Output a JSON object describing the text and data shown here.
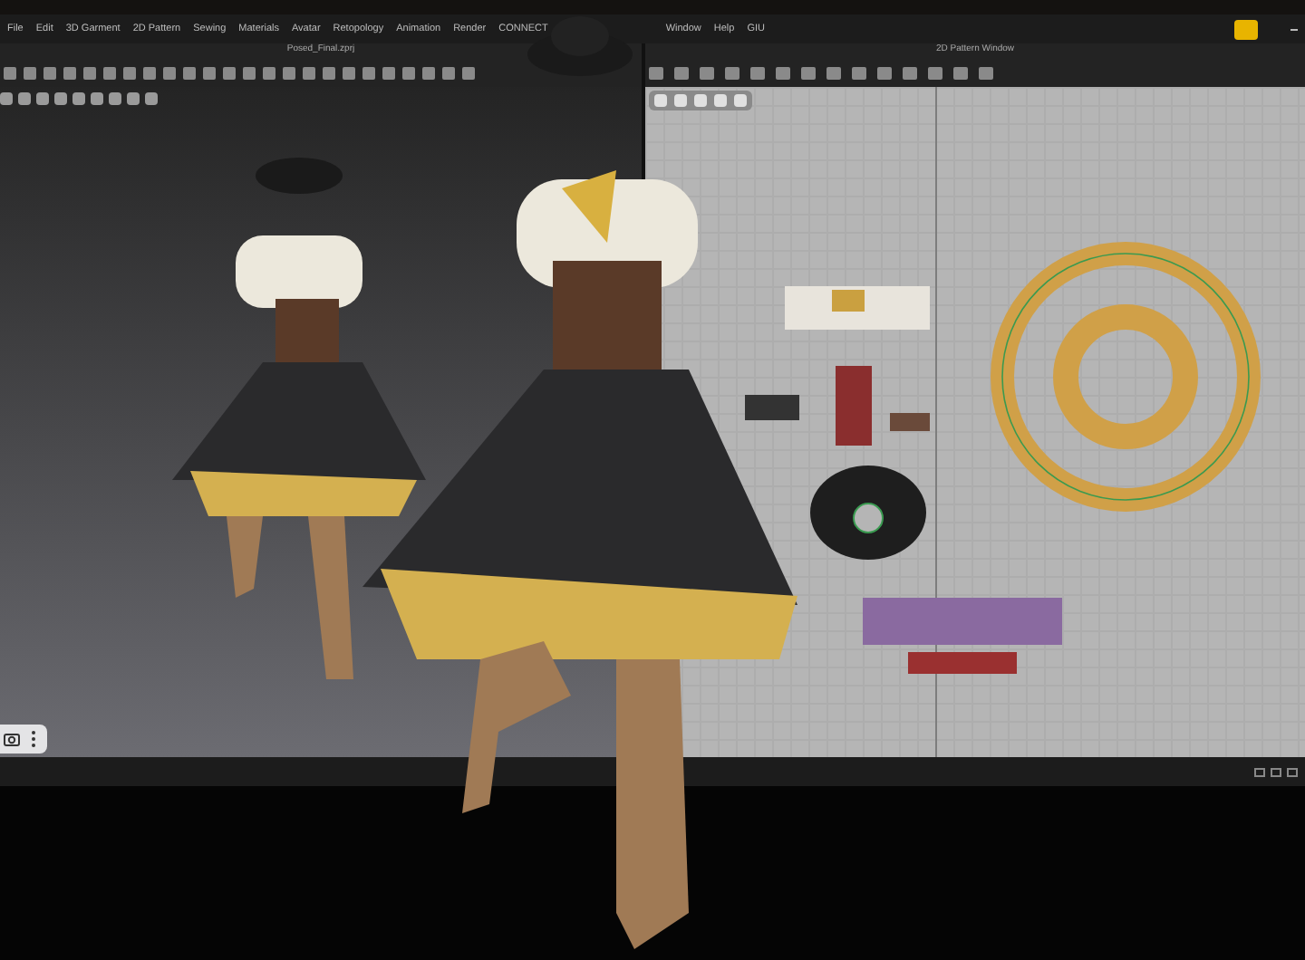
{
  "menu_bar": {
    "items": [
      "File",
      "Edit",
      "3D Garment",
      "2D Pattern",
      "Sewing",
      "Materials",
      "Avatar",
      "Retopology",
      "Animation",
      "Render",
      "CONNECT",
      "Window",
      "Help",
      "GIU"
    ]
  },
  "viewport_3d": {
    "title": "Posed_Final.zprj"
  },
  "pattern_window": {
    "title": "2D Pattern Window"
  }
}
